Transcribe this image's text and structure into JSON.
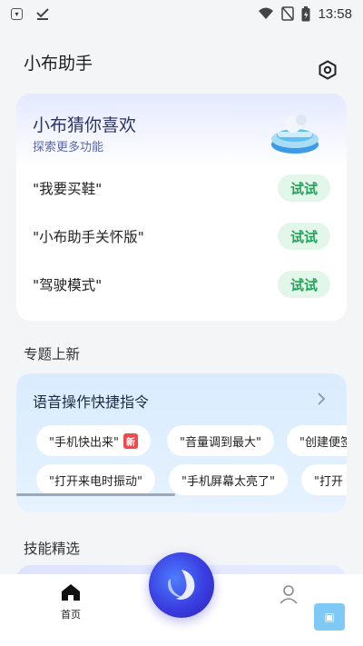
{
  "status_bar": {
    "time": "13:58",
    "icons": [
      "shield-icon",
      "download-done-icon",
      "wifi-icon",
      "no-sim-icon",
      "battery-icon"
    ]
  },
  "header": {
    "title": "小布助手",
    "settings_icon": "hexagon-settings-icon"
  },
  "guess_card": {
    "title": "小布猜你喜欢",
    "subtitle": "探索更多功能",
    "items": [
      {
        "text": "\"我要买鞋\"",
        "button": "试试"
      },
      {
        "text": "\"小布助手关怀版\"",
        "button": "试试"
      },
      {
        "text": "\"驾驶模式\"",
        "button": "试试"
      }
    ]
  },
  "topics": {
    "section_title": "专题上新",
    "card_title": "语音操作快捷指令",
    "row1": [
      {
        "text": "\"手机快出来\"",
        "badge": "新"
      },
      {
        "text": "\"音量调到最大\"",
        "badge": ""
      },
      {
        "text": "\"创建便签",
        "badge": ""
      }
    ],
    "row2": [
      {
        "text": "\"打开来电时振动\"",
        "badge": ""
      },
      {
        "text": "\"手机屏幕太亮了\"",
        "badge": ""
      },
      {
        "text": "\"打开",
        "badge": ""
      }
    ]
  },
  "skills": {
    "section_title": "技能精选"
  },
  "bottom_nav": {
    "home_label": "首页"
  },
  "colors": {
    "accent_green": "#24a35a",
    "card_title_blue": "#2c3563",
    "fab_blue": "#3a3de0"
  }
}
